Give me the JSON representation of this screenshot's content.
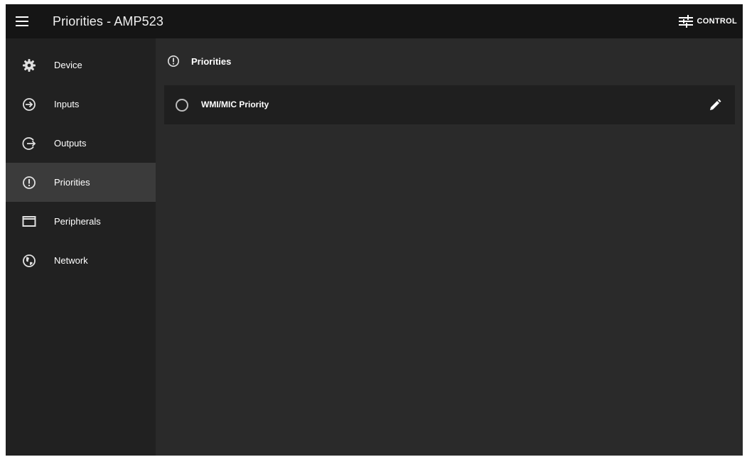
{
  "header": {
    "title": "Priorities - AMP523",
    "menu_icon": "hamburger-menu-icon",
    "control_icon": "sliders-icon",
    "control_label": "CONTROL"
  },
  "sidebar": {
    "items": [
      {
        "label": "Device",
        "icon": "gear-icon",
        "active": false
      },
      {
        "label": "Inputs",
        "icon": "input-arrow-icon",
        "active": false
      },
      {
        "label": "Outputs",
        "icon": "output-arrow-icon",
        "active": false
      },
      {
        "label": "Priorities",
        "icon": "alert-circle-icon",
        "active": true
      },
      {
        "label": "Peripherals",
        "icon": "display-icon",
        "active": false
      },
      {
        "label": "Network",
        "icon": "globe-icon",
        "active": false
      }
    ]
  },
  "main": {
    "section_title": "Priorities",
    "section_icon": "alert-circle-icon",
    "rows": [
      {
        "label": "WMI/MIC Priority",
        "selected": false,
        "edit_icon": "pencil-icon"
      }
    ]
  },
  "colors": {
    "topbar": "#151515",
    "sidebar": "#212121",
    "sidebar_active": "#3b3b3b",
    "content": "#2a2a2a",
    "row": "#1f1f1f",
    "text": "#ffffff"
  }
}
